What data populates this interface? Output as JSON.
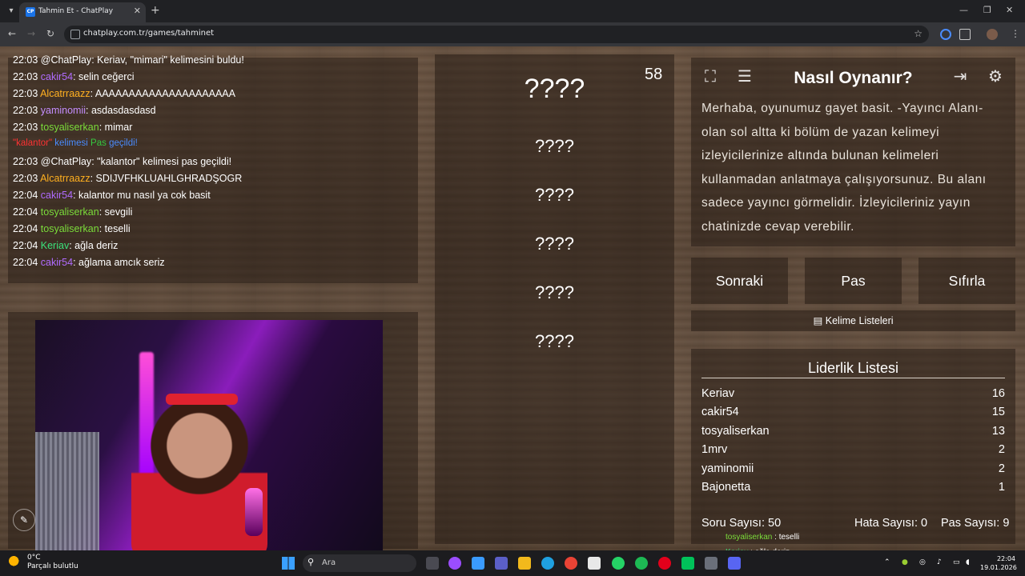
{
  "browser": {
    "tab_title": "Tahmin Et - ChatPlay",
    "favicon_text": "CP",
    "url": "chatplay.com.tr/games/tahminet"
  },
  "chat": {
    "lines": [
      {
        "time": "22:03",
        "user": "@ChatPlay",
        "msg": ": Keriav, \"mimari\" kelimesini buldu!"
      },
      {
        "time": "22:03",
        "user": "cakir54",
        "msg": ": selin ceğerci"
      },
      {
        "time": "22:03",
        "user": "Alcatrraazz",
        "msg": ": AAAAAAAAAAAAAAAAAAAAA"
      },
      {
        "time": "22:03",
        "user": "yaminomii",
        "msg": ": asdasdasdasd"
      },
      {
        "time": "22:03",
        "user": "tosyaliserkan",
        "msg": ": mimar"
      },
      {
        "time": "22:03",
        "user": "@ChatPlay",
        "msg": ": \"kalantor\" kelimesi pas geçildi!"
      },
      {
        "time": "22:03",
        "user": "Alcatrraazz",
        "msg": ": SDIJVFHKLUAHLGHRADŞOGR"
      },
      {
        "time": "22:04",
        "user": "cakir54",
        "msg": ": kalantor mu nasıl ya cok basit"
      },
      {
        "time": "22:04",
        "user": "tosyaliserkan",
        "msg": ": sevgili"
      },
      {
        "time": "22:04",
        "user": "tosyaliserkan",
        "msg": ": teselli"
      },
      {
        "time": "22:04",
        "user": "Keriav",
        "msg": ": ağla deriz"
      },
      {
        "time": "22:04",
        "user": "cakir54",
        "msg": ": ağlama amcık seriz"
      }
    ],
    "system_line": {
      "w1": "\"kalantor\"",
      "w2": "kelimesi",
      "w3": "Pas",
      "w4": "geçildi!"
    }
  },
  "game": {
    "timer": "58",
    "main_word": "????",
    "next_words": [
      "????",
      "????",
      "????",
      "????",
      "????"
    ]
  },
  "howto": {
    "title": "Nasıl Oynanır?",
    "text": "Merhaba, oyunumuz gayet basit. -Yayıncı Alanı- olan sol altta ki bölüm de yazan kelimeyi izleyicilerinize altında bulunan kelimeleri kullanmadan anlatmaya çalışıyorsunuz. Bu alanı sadece yayıncı görmelidir. İzleyicileriniz yayın chatinizde cevap verebilir."
  },
  "actions": {
    "next": "Sonraki",
    "pass": "Pas",
    "reset": "Sıfırla",
    "word_lists": "Kelime Listeleri"
  },
  "leaderboard": {
    "title": "Liderlik Listesi",
    "rows": [
      {
        "name": "Keriav",
        "score": "16"
      },
      {
        "name": "cakir54",
        "score": "15"
      },
      {
        "name": "tosyaliserkan",
        "score": "13"
      },
      {
        "name": "1mrv",
        "score": "2"
      },
      {
        "name": "yaminomii",
        "score": "2"
      },
      {
        "name": "Bajonetta",
        "score": "1"
      }
    ],
    "question_count": "Soru Sayısı: 50",
    "error_count": "Hata Sayısı: 0",
    "pass_count": "Pas Sayısı: 9"
  },
  "overlay": {
    "line1_user": "tosyaliserkan",
    "line1_msg": " : teselli",
    "line2_user": "Keriav",
    "line2_msg": " : ağla deriz"
  },
  "taskbar": {
    "temp": "0°C",
    "weather": "Parçalı bulutlu",
    "search": "Ara",
    "time": "22:04",
    "date": "19.01.2026"
  },
  "colors": {
    "cakir54": "#b06bff",
    "Alcatrraazz": "#ffb020",
    "yaminomii": "#c48dff",
    "tosyaliserkan": "#7bdc3a",
    "Keriav": "#3ae07a"
  }
}
